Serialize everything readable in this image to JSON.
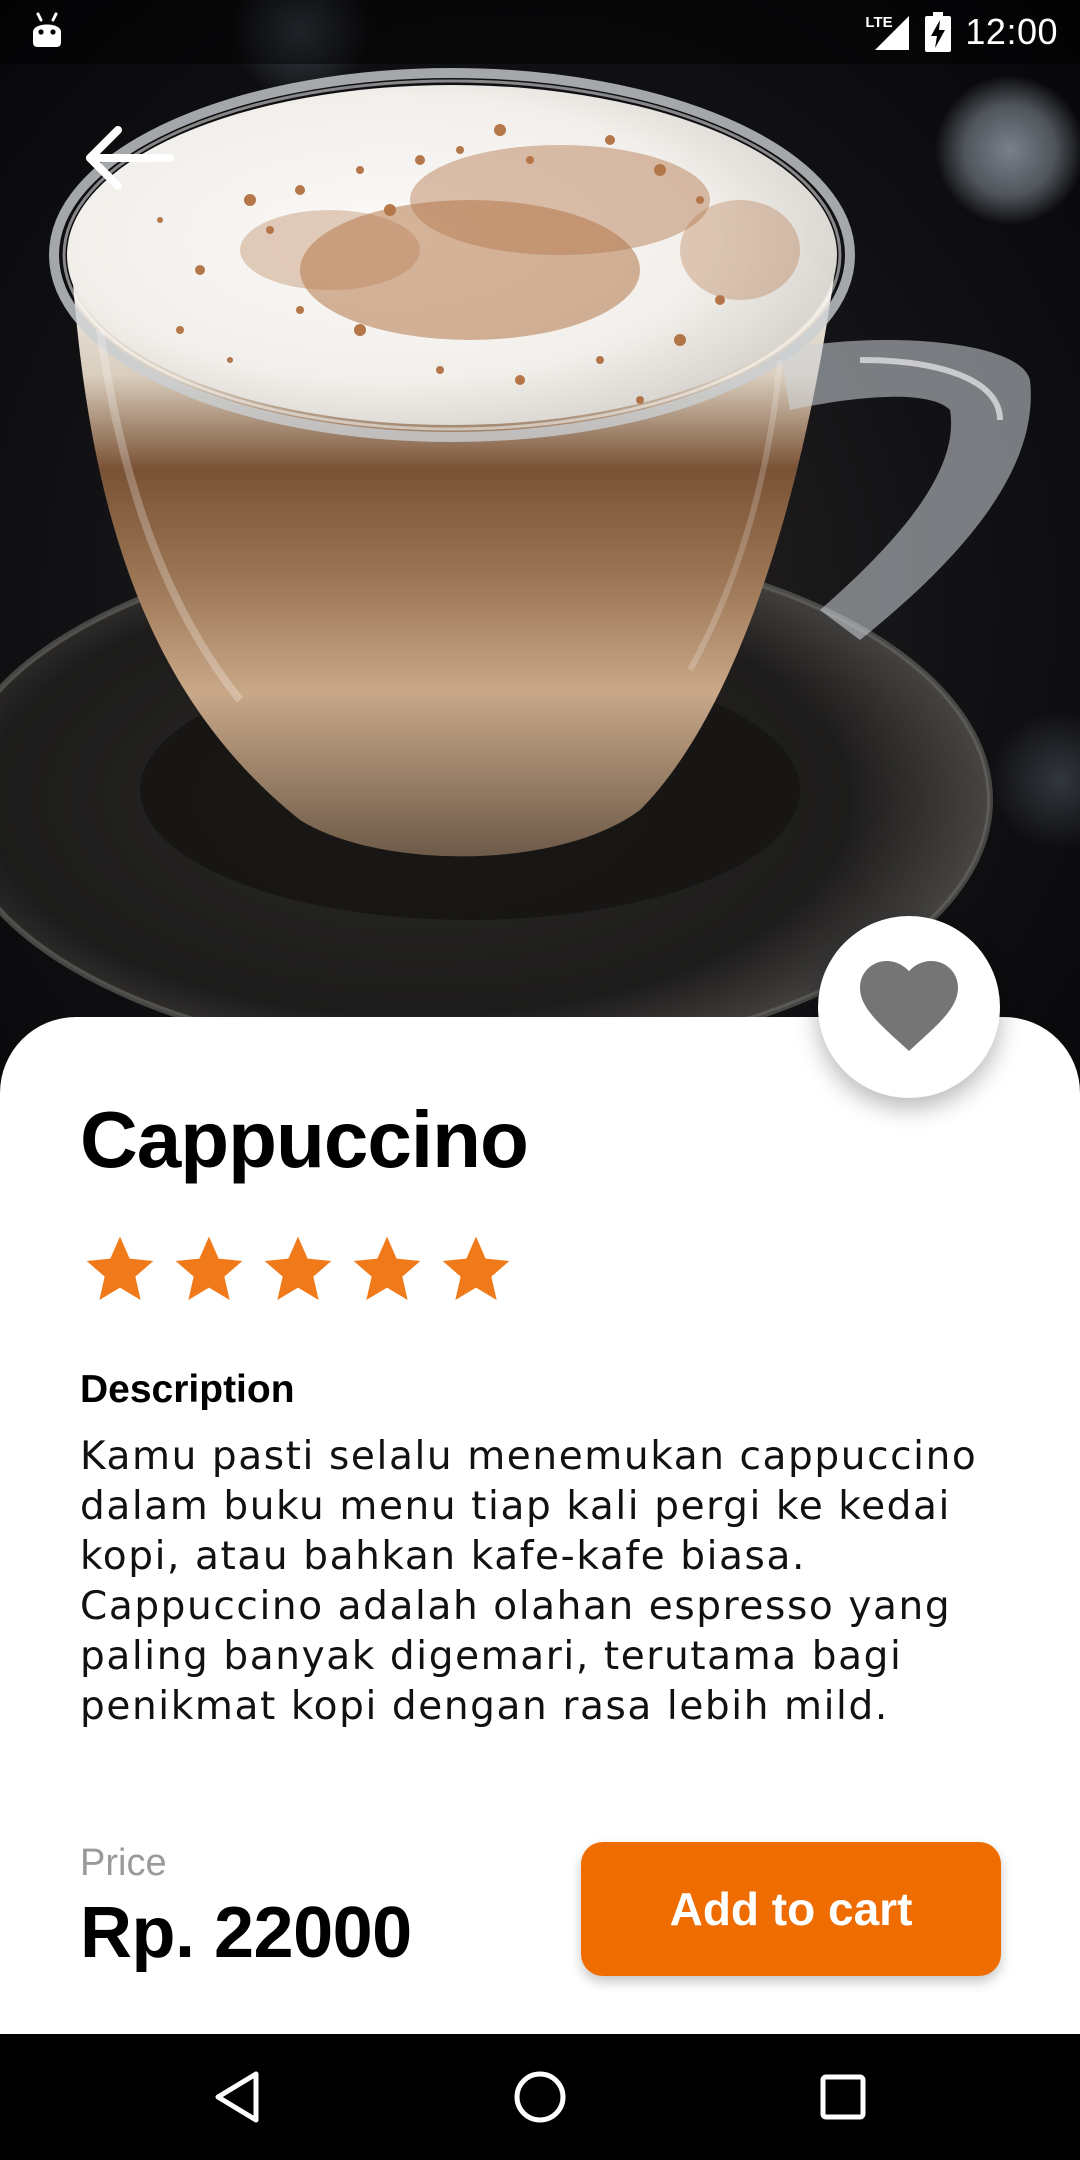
{
  "status_bar": {
    "network": "LTE",
    "time": "12:00"
  },
  "product": {
    "name": "Cappuccino",
    "rating": 5,
    "rating_max": 5,
    "description_heading": "Description",
    "description": "Kamu pasti selalu menemukan cappuccino dalam buku menu tiap kali pergi ke kedai kopi, atau bahkan kafe-kafe biasa. Cappuccino adalah olahan espresso yang paling banyak digemari, terutama bagi penikmat kopi dengan rasa lebih mild.",
    "price_label": "Price",
    "price": "Rp. 22000",
    "favorited": true,
    "image": "cappuccino-photo"
  },
  "actions": {
    "add_to_cart": "Add to cart"
  },
  "icons": {
    "back": "arrow-back-icon",
    "favorite": "heart-icon",
    "star": "star-icon",
    "nav_back": "triangle-back-icon",
    "nav_home": "circle-home-icon",
    "nav_recents": "square-recents-icon"
  },
  "colors": {
    "accent": "#EF6C00",
    "star": "#F07A1A",
    "heart": "#757575",
    "price_label": "#9A9A9A"
  }
}
